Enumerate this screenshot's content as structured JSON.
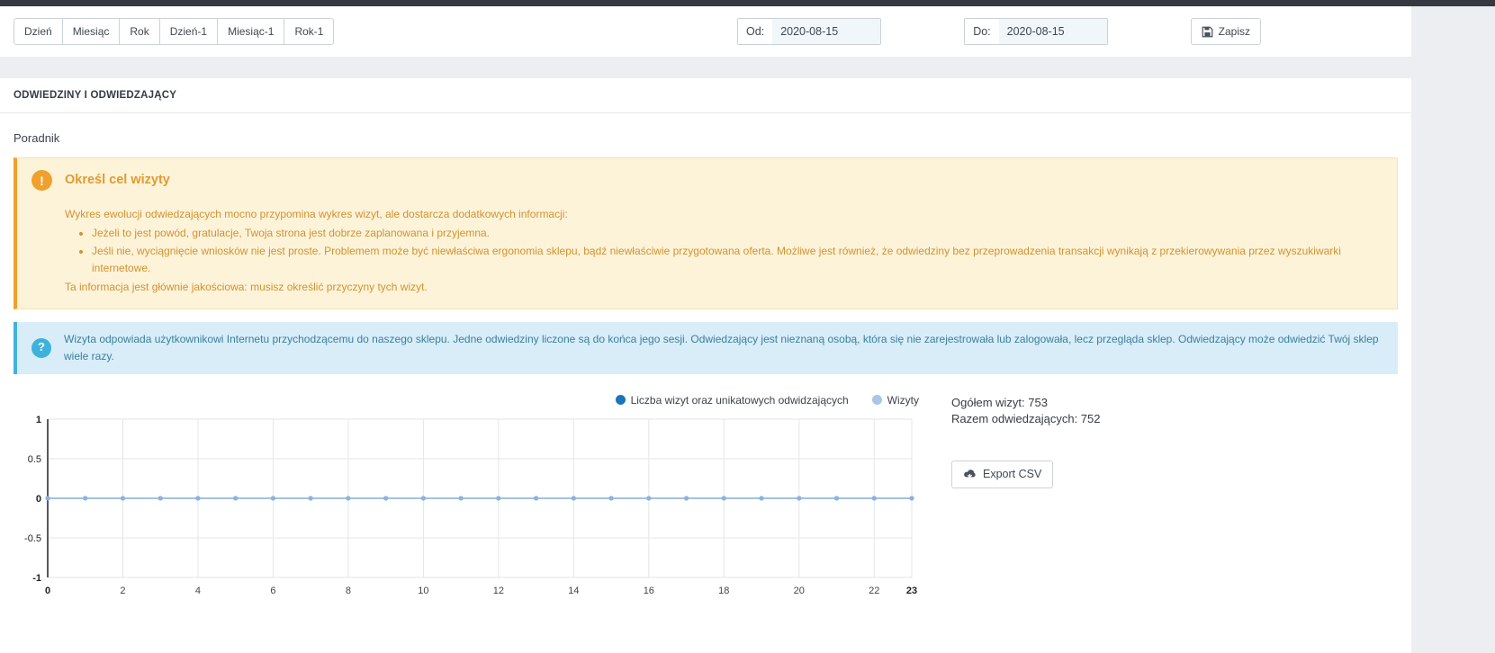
{
  "toolbar": {
    "range_buttons": [
      "Dzień",
      "Miesiąc",
      "Rok",
      "Dzień-1",
      "Miesiąc-1",
      "Rok-1"
    ],
    "from_label": "Od:",
    "from_value": "2020-08-15",
    "to_label": "Do:",
    "to_value": "2020-08-15",
    "save_label": "Zapisz"
  },
  "section": {
    "title": "ODWIEDZINY I ODWIEDZAJĄCY",
    "guide_label": "Poradnik"
  },
  "warning_box": {
    "title": "Określ cel wizyty",
    "intro": "Wykres ewolucji odwiedzających mocno przypomina wykres wizyt, ale dostarcza dodatkowych informacji:",
    "bullets": [
      "Jeżeli to jest powód, gratulacje, Twoja strona jest dobrze zaplanowana i przyjemna.",
      "Jeśli nie, wyciągnięcie wniosków nie jest proste. Problemem może być niewłaściwa ergonomia sklepu, bądź niewłaściwie przygotowana oferta. Możliwe jest również, że odwiedziny bez przeprowadzenia transakcji wynikają z przekierowywania przez wyszukiwarki internetowe."
    ],
    "outro": "Ta informacja jest głównie jakościowa: musisz określić przyczyny tych wizyt."
  },
  "info_box": {
    "text": "Wizyta odpowiada użytkownikowi Internetu przychodzącemu do naszego sklepu. Jedne odwiedziny liczone są do końca jego sesji. Odwiedzający jest nieznaną osobą, która się nie zarejestrowała lub zalogowała, lecz przegląda sklep. Odwiedzający może odwiedzić Twój sklep wiele razy."
  },
  "stats": {
    "total_visits": "Ogółem wizyt: 753",
    "total_visitors": "Razem odwiedzających: 752",
    "export_label": "Export CSV"
  },
  "chart_data": {
    "type": "line",
    "title": "",
    "legend_position": "top-right",
    "grid": true,
    "legend": [
      {
        "label": "Liczba wizyt oraz unikatowych odwidzających",
        "color": "#1b75ba"
      },
      {
        "label": "Wizyty",
        "color": "#a9c6e6"
      }
    ],
    "x": [
      0,
      1,
      2,
      3,
      4,
      5,
      6,
      7,
      8,
      9,
      10,
      11,
      12,
      13,
      14,
      15,
      16,
      17,
      18,
      19,
      20,
      21,
      22,
      23
    ],
    "series": [
      {
        "name": "Liczba wizyt oraz unikatowych odwidzających",
        "line_color": "#1b75ba",
        "point_color": "#1b75ba",
        "values": [
          0,
          0,
          0,
          0,
          0,
          0,
          0,
          0,
          0,
          0,
          0,
          0,
          0,
          0,
          0,
          0,
          0,
          0,
          0,
          0,
          0,
          0,
          0,
          0
        ]
      },
      {
        "name": "Wizyty",
        "line_color": "#a9c6e6",
        "point_color": "#8fb2dc",
        "values": [
          0,
          0,
          0,
          0,
          0,
          0,
          0,
          0,
          0,
          0,
          0,
          0,
          0,
          0,
          0,
          0,
          0,
          0,
          0,
          0,
          0,
          0,
          0,
          0
        ]
      }
    ],
    "xticks": [
      0,
      2,
      4,
      6,
      8,
      10,
      12,
      14,
      16,
      18,
      20,
      22,
      23
    ],
    "yticks": [
      -1,
      -0.5,
      0,
      0.5,
      1
    ],
    "xlim": [
      0,
      23
    ],
    "ylim": [
      -1,
      1
    ],
    "xlabel": "",
    "ylabel": ""
  }
}
